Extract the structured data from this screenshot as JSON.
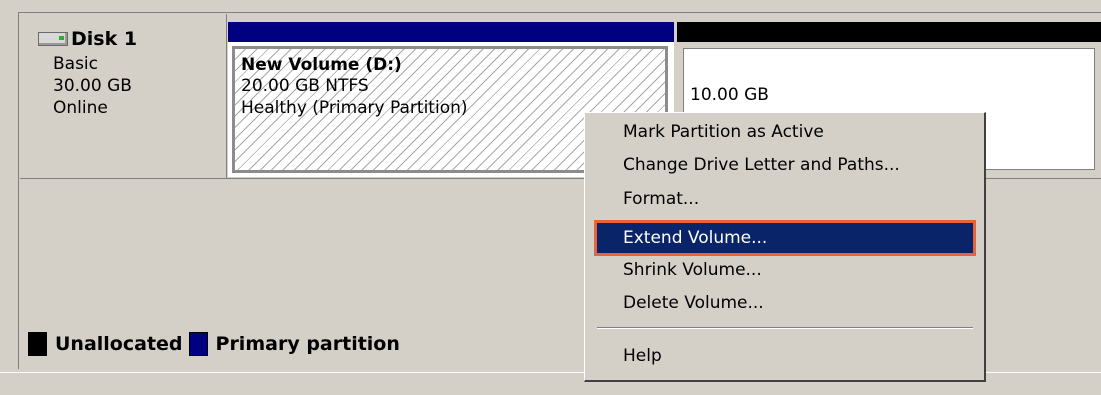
{
  "disk": {
    "name": "Disk 1",
    "type": "Basic",
    "size": "30.00 GB",
    "status": "Online",
    "icon": "hard-disk-icon"
  },
  "partitions": {
    "d": {
      "name": "New Volume  (D:)",
      "detail": "20.00 GB NTFS",
      "status": "Healthy (Primary Partition)",
      "bar_color": "#000080"
    },
    "unallocated": {
      "size": "10.00 GB",
      "bar_color": "#000000"
    }
  },
  "legend": [
    {
      "label": "Unallocated",
      "color": "#000000"
    },
    {
      "label": "Primary partition",
      "color": "#000080"
    }
  ],
  "context_menu": {
    "items": [
      "Mark Partition as Active",
      "Change Drive Letter and Paths...",
      "Format...",
      "Extend Volume...",
      "Shrink Volume...",
      "Delete Volume...",
      "Help"
    ],
    "selected": "Extend Volume...",
    "highlight_color": "#e8633a"
  }
}
